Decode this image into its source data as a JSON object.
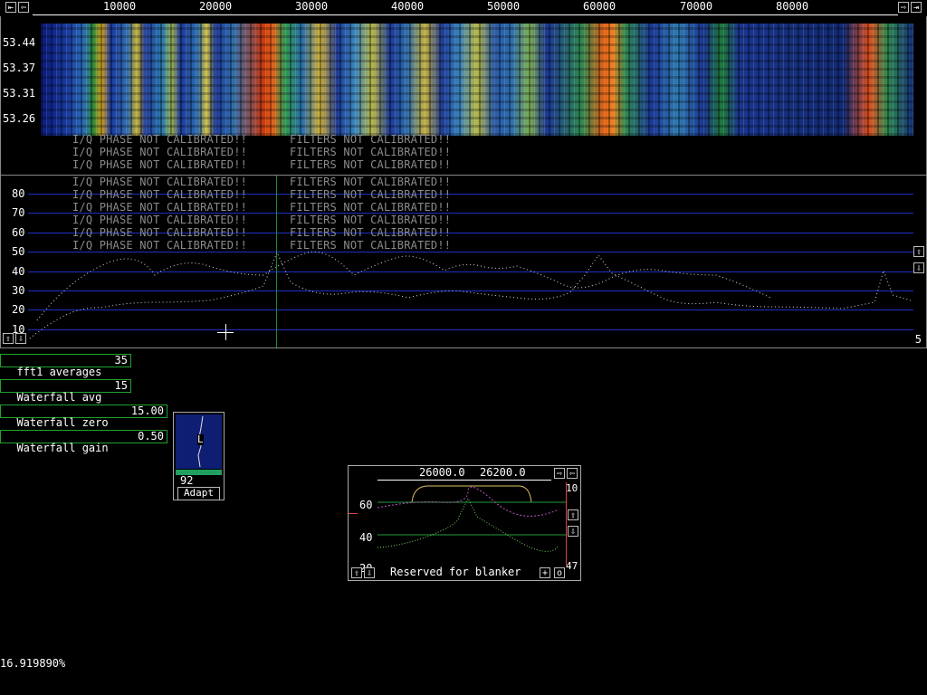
{
  "top_axis": {
    "labels": [
      "10000",
      "20000",
      "30000",
      "40000",
      "50000",
      "60000",
      "70000",
      "80000"
    ],
    "left_icon": "left-arrow-icon",
    "right_icon": "right-arrow-icon"
  },
  "waterfall": {
    "time_labels": [
      "53.44",
      "53.37",
      "53.31",
      "53.26"
    ]
  },
  "warnings": {
    "phase": "I/Q PHASE NOT CALIBRATED!!",
    "filters": "FILTERS NOT CALIBRATED!!"
  },
  "spectrum": {
    "y_labels": [
      "80",
      "70",
      "60",
      "50",
      "40",
      "30",
      "20",
      "10"
    ],
    "corner_value": "5",
    "grid_color": "#1a30c8"
  },
  "params": {
    "fft1_avg_label": "fft1 averages",
    "fft1_avg_value": "35",
    "wf_avg_label": "Waterfall avg",
    "wf_avg_value": "15",
    "wf_zero_label": "Waterfall zero",
    "wf_zero_value": "15.00",
    "wf_gain_label": "Waterfall gain",
    "wf_gain_value": "0.50"
  },
  "agc": {
    "value": "92",
    "adapt_label": "Adapt",
    "marker": "L"
  },
  "baseband": {
    "freq_left": "26000.0",
    "freq_right": "26200.0",
    "y_labels": [
      "60",
      "40",
      "20"
    ],
    "right_top": "10",
    "right_bottom": "47",
    "status": "Reserved for blanker",
    "plus": "+",
    "o": "o"
  },
  "footer": {
    "percent": "16.919890%"
  }
}
